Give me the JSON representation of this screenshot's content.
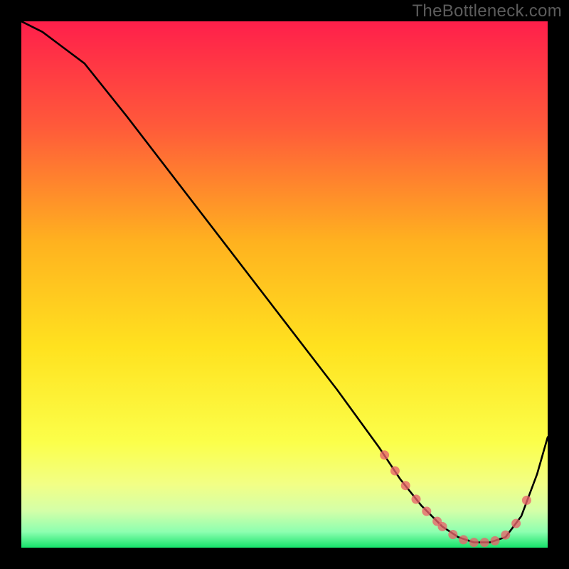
{
  "watermark": "TheBottleneck.com",
  "colors": {
    "background": "#000000",
    "gradient_top": "#ff1f4b",
    "gradient_upper_mid": "#ff7a2a",
    "gradient_mid": "#ffd21f",
    "gradient_lower": "#f6ff60",
    "gradient_band": "#c7ffb0",
    "gradient_bottom": "#16e36b",
    "curve": "#000000",
    "markers": "#e9636a",
    "watermark": "#5c5c5c"
  },
  "chart_data": {
    "type": "line",
    "title": "",
    "xlabel": "",
    "ylabel": "",
    "xlim": [
      0,
      100
    ],
    "ylim": [
      0,
      100
    ],
    "series": [
      {
        "name": "bottleneck-curve",
        "x": [
          0,
          4,
          8,
          12,
          20,
          30,
          40,
          50,
          60,
          68,
          72,
          76,
          80,
          83,
          86,
          89,
          92,
          95,
          98,
          100
        ],
        "y": [
          100,
          98,
          95,
          92,
          82,
          69,
          56,
          43,
          30,
          19,
          13,
          8,
          4,
          2,
          1,
          1,
          2,
          6,
          14,
          21
        ]
      }
    ],
    "markers": {
      "name": "highlight-region",
      "x": [
        69,
        71,
        73,
        75,
        77,
        79,
        80,
        82,
        84,
        86,
        88,
        90,
        92,
        94,
        96
      ],
      "y": [
        17.6,
        14.6,
        11.8,
        9.2,
        6.9,
        5.0,
        4.0,
        2.5,
        1.5,
        1.0,
        1.0,
        1.3,
        2.4,
        4.6,
        9.0
      ]
    }
  }
}
